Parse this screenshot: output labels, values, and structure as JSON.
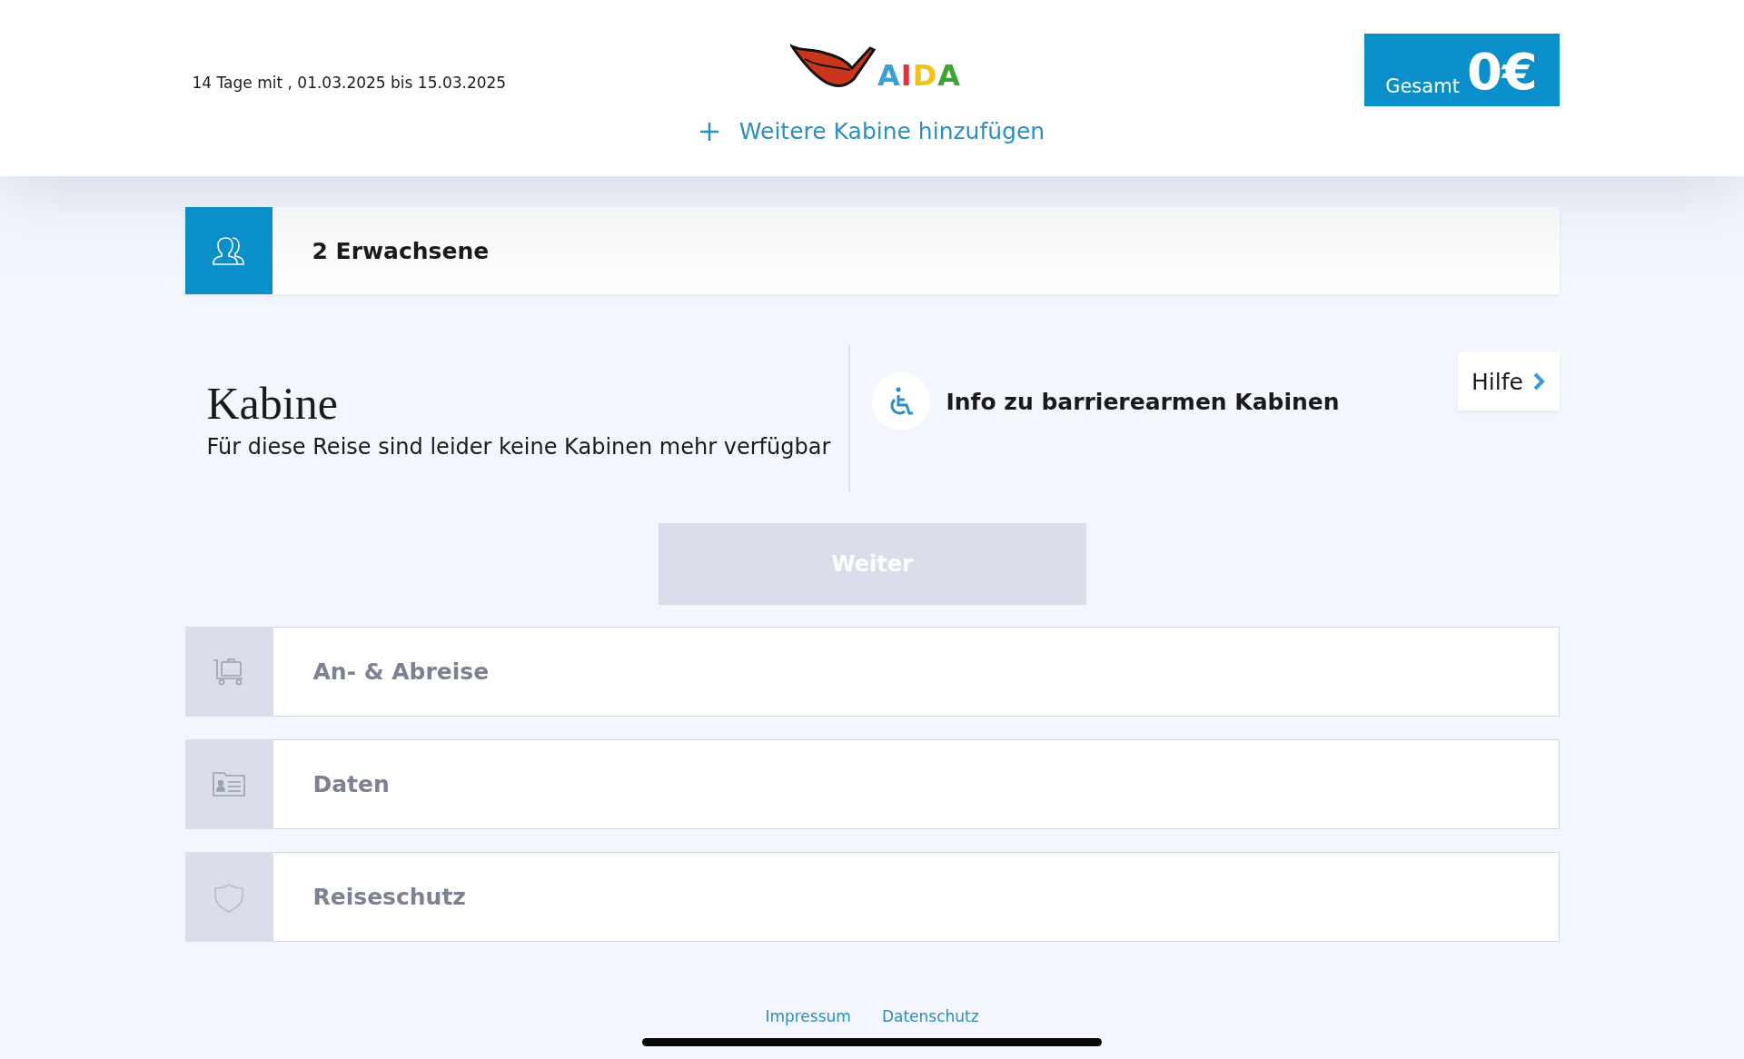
{
  "header": {
    "trip_dates": "14 Tage mit , 01.03.2025 bis 15.03.2025",
    "logo_text": "AIDA",
    "total_label": "Gesamt",
    "total_amount": "0€",
    "add_cabin": "Weitere Kabine hinzufügen"
  },
  "travelers": {
    "label": "2 Erwachsene"
  },
  "cabin": {
    "title": "Kabine",
    "message": "Für diese Reise sind leider keine Kabinen mehr verfügbar",
    "accessibility_info": "Info zu barrierearmen Kabinen",
    "help": "Hilfe"
  },
  "continue_button": {
    "label": "Weiter",
    "disabled": true
  },
  "steps": [
    {
      "kind": "travel",
      "label": "An- & Abreise",
      "disabled": true
    },
    {
      "kind": "data",
      "label": "Daten",
      "disabled": true
    },
    {
      "kind": "insurance",
      "label": "Reiseschutz",
      "disabled": true
    }
  ],
  "footer": {
    "links": [
      "Impressum",
      "Datenschutz"
    ]
  }
}
